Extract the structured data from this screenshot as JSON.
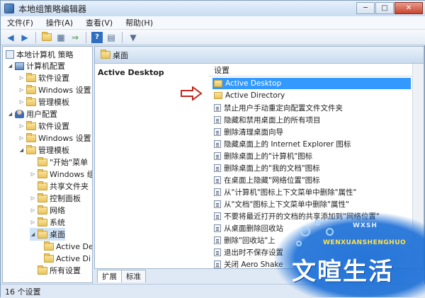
{
  "window": {
    "title": "本地组策略编辑器",
    "controls": {
      "minimize": "─",
      "maximize": "□",
      "close": "✕"
    }
  },
  "menu": [
    "文件(F)",
    "操作(A)",
    "查看(V)",
    "帮助(H)"
  ],
  "toolbar_icons": [
    "back-icon",
    "forward-icon",
    "up-folder-icon",
    "show-tree-icon",
    "export-list-icon",
    "help-icon",
    "properties-icon",
    "filter-icon"
  ],
  "tree": {
    "root": "本地计算机 策略",
    "computer_config": "计算机配置",
    "cc_software": "软件设置",
    "cc_windows": "Windows 设置",
    "cc_admin": "管理模板",
    "user_config": "用户配置",
    "uc_software": "软件设置",
    "uc_windows": "Windows 设置",
    "uc_admin": "管理模板",
    "start_menu": "\"开始\"菜单",
    "windows_components": "Windows 组件",
    "shared_folders": "共享文件夹",
    "control_panel": "控制面板",
    "network": "网络",
    "system": "系统",
    "desktop": "桌面",
    "active_desktop_1": "Active De",
    "active_directory_1": "Active Di",
    "all_settings": "所有设置"
  },
  "right": {
    "header": "桌面",
    "desc_title": "Active Desktop",
    "column_header": "设置",
    "items": [
      "Active Desktop",
      "Active Directory",
      "禁止用户手动重定向配置文件文件夹",
      "隐藏和禁用桌面上的所有项目",
      "删除清理桌面向导",
      "隐藏桌面上的 Internet Explorer 图标",
      "删除桌面上的\"计算机\"图标",
      "删除桌面上的\"我的文档\"图标",
      "在桌面上隐藏\"网络位置\"图标",
      "从\"计算机\"图标上下文菜单中删除\"属性\"",
      "从\"文档\"图标上下文菜单中删除\"属性\"",
      "不要将最近打开的文档的共享添加到\"网络位置\"",
      "从桌面删除回收站",
      "删除\"回收站\"上",
      "退出时不保存设置",
      "关闭 Aero Shake"
    ]
  },
  "tabs": [
    "扩展",
    "标准"
  ],
  "status": "16 个设置",
  "watermark": {
    "small": "WXSH",
    "en": "WENXUANSHENGHUO",
    "main": "文暄生活"
  }
}
